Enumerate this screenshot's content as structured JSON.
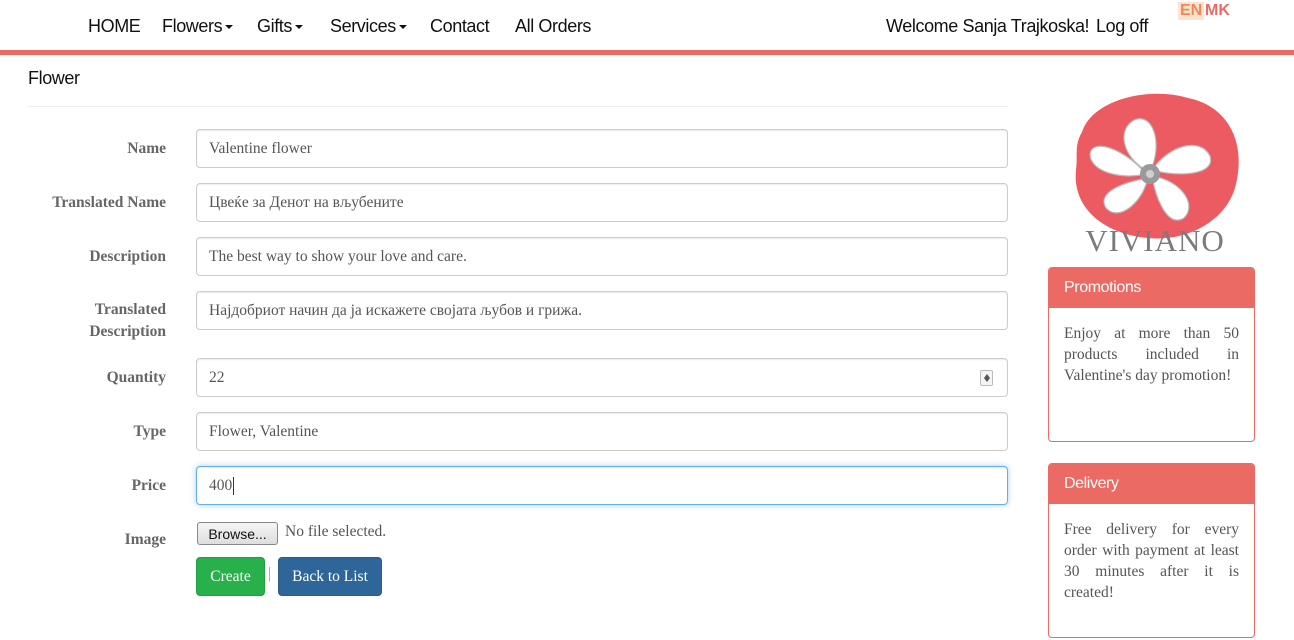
{
  "nav": {
    "home": "HOME",
    "flowers": "Flowers",
    "gifts": "Gifts",
    "services": "Services",
    "contact": "Contact",
    "all_orders": "All Orders",
    "welcome": "Welcome Sanja Trajkoska!",
    "logoff": "Log off",
    "lang_en": "EN",
    "lang_mk": "MK"
  },
  "page": {
    "title": "Flower"
  },
  "form": {
    "name_label": "Name",
    "name_value": "Valentine flower",
    "translated_name_label": "Translated Name",
    "translated_name_value": "Цвеќе за Денот на вљубените",
    "description_label": "Description",
    "description_value": "The best way to show your love and care.",
    "translated_description_label_1": "Translated",
    "translated_description_label_2": "Description",
    "translated_description_value": "Најдобриот начин да ја искажете својата љубов и грижа.",
    "quantity_label": "Quantity",
    "quantity_value": "22",
    "type_label": "Type",
    "type_value": "Flower, Valentine",
    "price_label": "Price",
    "price_value": "400",
    "image_label": "Image",
    "browse_label": "Browse...",
    "no_file_text": "No file selected.",
    "create_label": "Create",
    "separator": "|",
    "back_label": "Back to List"
  },
  "sidebar": {
    "logo_text": "VIVIANO",
    "promotions_title": "Promotions",
    "promotions_text": "Enjoy at more than 50 products included in Valentine's day promotion!",
    "delivery_title": "Delivery",
    "delivery_text": "Free delivery for every order with payment at least 30 minutes after it is created!"
  },
  "colors": {
    "accent": "#ec6a64",
    "create_button": "#28b04b",
    "back_button": "#2f6699",
    "logo_text": "#7b7b7b"
  }
}
